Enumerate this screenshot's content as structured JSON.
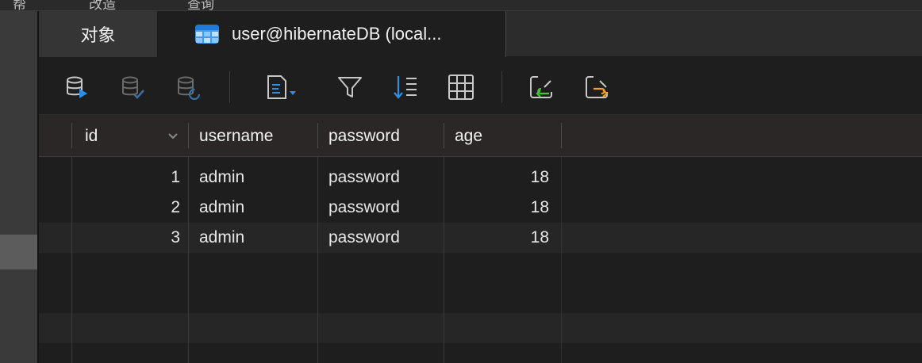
{
  "top_menu": {
    "items": [
      "帮",
      "改造",
      "查询"
    ]
  },
  "tabs": [
    {
      "label": "对象",
      "active": false
    },
    {
      "label": "user@hibernateDB (local...",
      "active": true
    }
  ],
  "toolbar": {
    "buttons": [
      {
        "icon": "db-run-icon"
      },
      {
        "icon": "db-commit-icon"
      },
      {
        "icon": "db-rollback-icon"
      },
      {
        "icon": "text-dropdown-icon"
      },
      {
        "icon": "filter-icon"
      },
      {
        "icon": "sort-icon"
      },
      {
        "icon": "grid-icon"
      },
      {
        "icon": "import-icon"
      },
      {
        "icon": "export-icon"
      }
    ]
  },
  "grid": {
    "columns": [
      "id",
      "username",
      "password",
      "age"
    ],
    "rows": [
      {
        "id": "1",
        "username": "admin",
        "password": "password",
        "age": "18"
      },
      {
        "id": "2",
        "username": "admin",
        "password": "password",
        "age": "18"
      },
      {
        "id": "3",
        "username": "admin",
        "password": "password",
        "age": "18"
      }
    ]
  },
  "colors": {
    "accent_blue": "#2f8ee6",
    "green": "#49c23a",
    "orange": "#f0a030"
  }
}
